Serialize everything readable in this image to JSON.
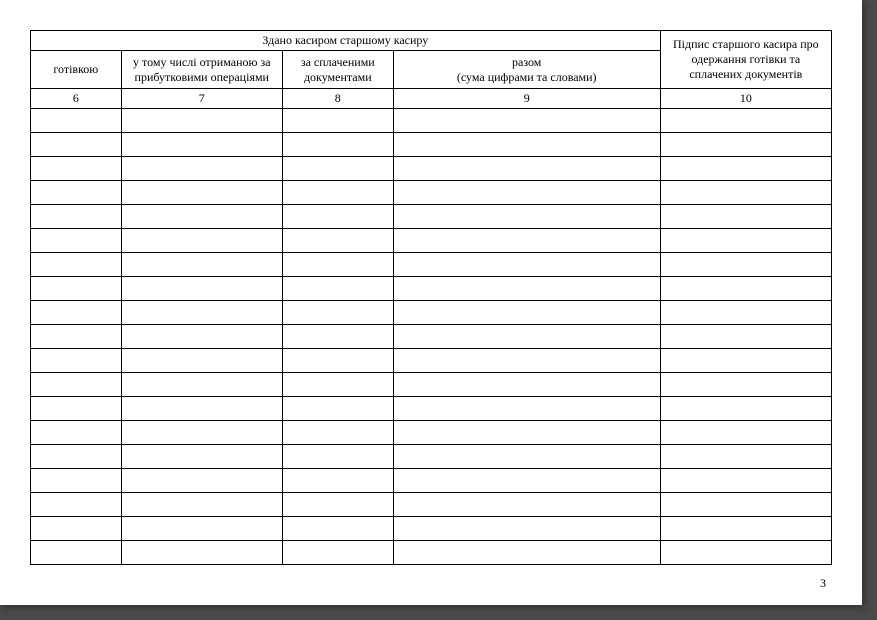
{
  "table": {
    "group_header": "Здано касиром старшому касиру",
    "col5_header": "Підпис старшого касира про одержання готівки та сплачених документів",
    "columns": {
      "c1": "готівкою",
      "c2": "у тому числі отриманою за прибутковими операціями",
      "c3": "за сплаченими документами",
      "c4": "разом\n(сума цифрами та словами)"
    },
    "numbers": {
      "n1": "6",
      "n2": "7",
      "n3": "8",
      "n4": "9",
      "n5": "10"
    },
    "rows_count": 19
  },
  "page_number": "3"
}
